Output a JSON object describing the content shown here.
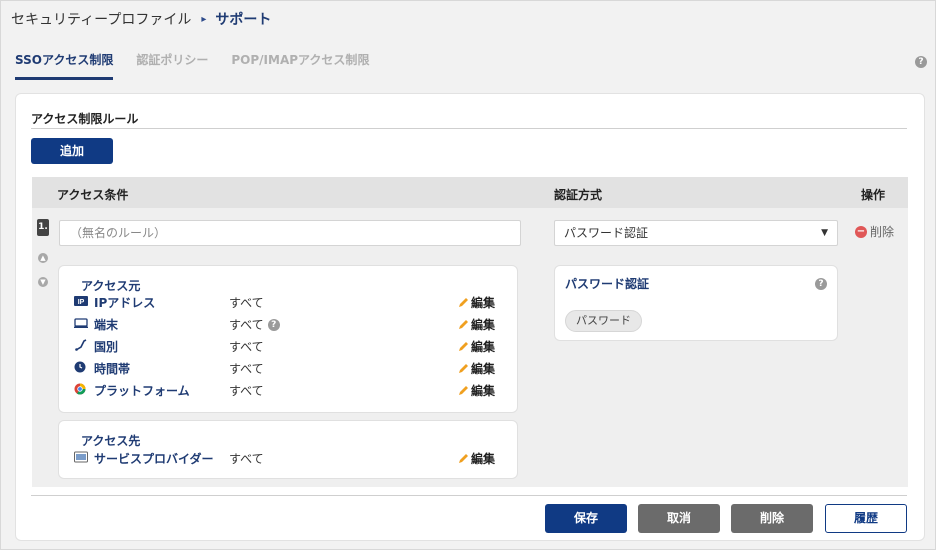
{
  "breadcrumb": {
    "parent": "セキュリティープロファイル",
    "separator": "▸",
    "current": "サポート"
  },
  "tabs": [
    {
      "label": "SSOアクセス制限",
      "active": true
    },
    {
      "label": "認証ポリシー",
      "active": false
    },
    {
      "label": "POP/IMAPアクセス制限",
      "active": false
    }
  ],
  "section": {
    "title": "アクセス制限ルール",
    "add_button": "追加"
  },
  "table": {
    "col_condition": "アクセス条件",
    "col_auth": "認証方式",
    "col_ops": "操作"
  },
  "rule": {
    "number": "1.",
    "name_placeholder": "（無名のルール）",
    "source": {
      "title": "アクセス元",
      "rows": [
        {
          "icon": "ip-icon",
          "label": "IPアドレス",
          "value": "すべて",
          "edit": "編集"
        },
        {
          "icon": "device-icon",
          "label": "端末",
          "value": "すべて",
          "edit": "編集"
        },
        {
          "icon": "country-icon",
          "label": "国別",
          "value": "すべて",
          "edit": "編集"
        },
        {
          "icon": "clock-icon",
          "label": "時間帯",
          "value": "すべて",
          "edit": "編集"
        },
        {
          "icon": "platform-icon",
          "label": "プラットフォーム",
          "value": "すべて",
          "edit": "編集"
        }
      ]
    },
    "destination": {
      "title": "アクセス先",
      "rows": [
        {
          "icon": "service-provider-icon",
          "label": "サービスプロバイダー",
          "value": "すべて",
          "edit": "編集"
        }
      ]
    },
    "auth_method": "パスワード認証",
    "auth_box": {
      "title": "パスワード認証",
      "pill": "パスワード"
    },
    "delete_label": "削除"
  },
  "footer": {
    "save": "保存",
    "cancel": "取消",
    "delete": "削除",
    "history": "履歴"
  },
  "colors": {
    "brand": "#103a84",
    "tab_active": "#1f3b73",
    "danger": "#e05757",
    "edit_pencil": "#f0a020"
  }
}
